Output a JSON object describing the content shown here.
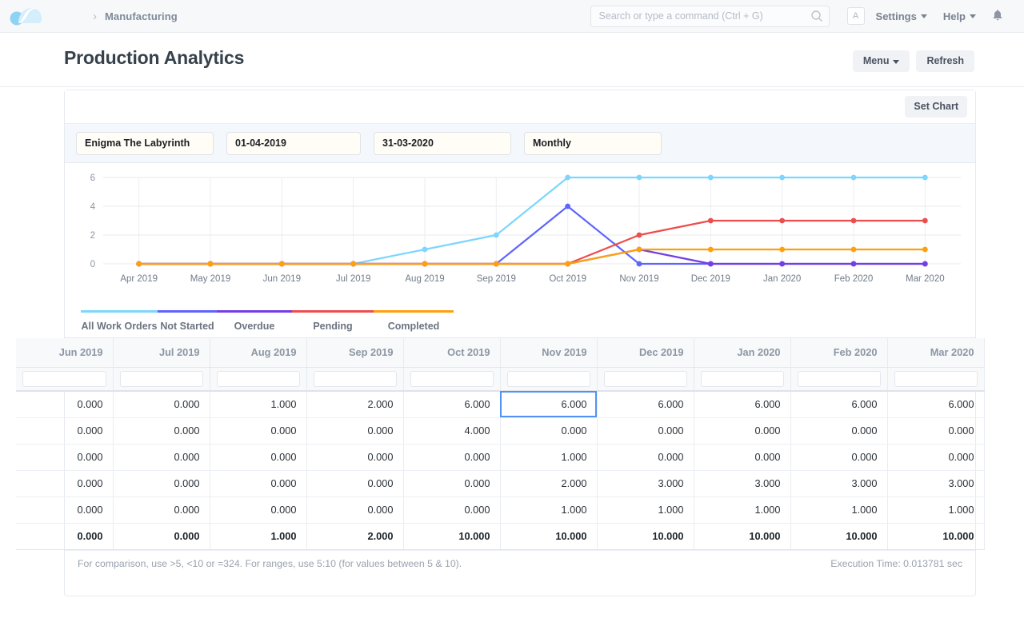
{
  "navbar": {
    "logo_icon": "cloud-logo-icon",
    "breadcrumb_separator": "›",
    "breadcrumb": "Manufacturing",
    "search_placeholder": "Search or type a command (Ctrl + G)",
    "search_value": "",
    "search_icon": "search-icon",
    "avatar_initial": "A",
    "settings_label": "Settings",
    "help_label": "Help",
    "bell_icon": "bell-icon"
  },
  "header": {
    "title": "Production Analytics",
    "menu_label": "Menu",
    "refresh_label": "Refresh"
  },
  "card": {
    "set_chart_label": "Set Chart"
  },
  "filters": {
    "report_name": "Enigma The Labyrinth",
    "from_date": "01-04-2019",
    "to_date": "31-03-2020",
    "range": "Monthly"
  },
  "chart_data": {
    "type": "line",
    "title": "",
    "xlabel": "",
    "ylabel": "",
    "ylim": [
      0,
      6
    ],
    "yticks": [
      0,
      2,
      4,
      6
    ],
    "grid": true,
    "legend_position": "bottom",
    "categories": [
      "Apr 2019",
      "May 2019",
      "Jun 2019",
      "Jul 2019",
      "Aug 2019",
      "Sep 2019",
      "Oct 2019",
      "Nov 2019",
      "Dec 2019",
      "Jan 2020",
      "Feb 2020",
      "Mar 2020"
    ],
    "series": [
      {
        "name": "All Work Orders",
        "color": "#7cd6fd",
        "values": [
          0,
          0,
          0,
          0,
          1,
          2,
          6,
          6,
          6,
          6,
          6,
          6
        ]
      },
      {
        "name": "Not Started",
        "color": "#5e64ff",
        "values": [
          0,
          0,
          0,
          0,
          0,
          0,
          4,
          0,
          0,
          0,
          0,
          0
        ]
      },
      {
        "name": "Overdue",
        "color": "#743ee2",
        "values": [
          0,
          0,
          0,
          0,
          0,
          0,
          0,
          1,
          0,
          0,
          0,
          0
        ]
      },
      {
        "name": "Pending",
        "color": "#ec4d4d",
        "values": [
          0,
          0,
          0,
          0,
          0,
          0,
          0,
          2,
          3,
          3,
          3,
          3
        ]
      },
      {
        "name": "Completed",
        "color": "#ffa00a",
        "values": [
          0,
          0,
          0,
          0,
          0,
          0,
          0,
          1,
          1,
          1,
          1,
          1
        ]
      }
    ]
  },
  "table": {
    "columns": [
      "Jun 2019",
      "Jul 2019",
      "Aug 2019",
      "Sep 2019",
      "Oct 2019",
      "Nov 2019",
      "Dec 2019",
      "Jan 2020",
      "Feb 2020",
      "Mar 2020"
    ],
    "filter_values": [
      "",
      "",
      "",
      "",
      "",
      "",
      "",
      "",
      "",
      ""
    ],
    "rows": [
      {
        "cells": [
          "0.000",
          "0.000",
          "1.000",
          "2.000",
          "6.000",
          "6.000",
          "6.000",
          "6.000",
          "6.000",
          "6.000"
        ]
      },
      {
        "cells": [
          "0.000",
          "0.000",
          "0.000",
          "0.000",
          "4.000",
          "0.000",
          "0.000",
          "0.000",
          "0.000",
          "0.000"
        ]
      },
      {
        "cells": [
          "0.000",
          "0.000",
          "0.000",
          "0.000",
          "0.000",
          "1.000",
          "0.000",
          "0.000",
          "0.000",
          "0.000"
        ]
      },
      {
        "cells": [
          "0.000",
          "0.000",
          "0.000",
          "0.000",
          "0.000",
          "2.000",
          "3.000",
          "3.000",
          "3.000",
          "3.000"
        ]
      },
      {
        "cells": [
          "0.000",
          "0.000",
          "0.000",
          "0.000",
          "0.000",
          "1.000",
          "1.000",
          "1.000",
          "1.000",
          "1.000"
        ]
      }
    ],
    "total_row": {
      "cells": [
        "0.000",
        "0.000",
        "1.000",
        "2.000",
        "10.000",
        "10.000",
        "10.000",
        "10.000",
        "10.000",
        "10.000"
      ]
    },
    "selected_cell": {
      "row": 0,
      "col": 5
    }
  },
  "footer": {
    "hint": "For comparison, use >5, <10 or =324. For ranges, use 5:10 (for values between 5 & 10).",
    "execution_time": "Execution Time: 0.013781 sec"
  }
}
